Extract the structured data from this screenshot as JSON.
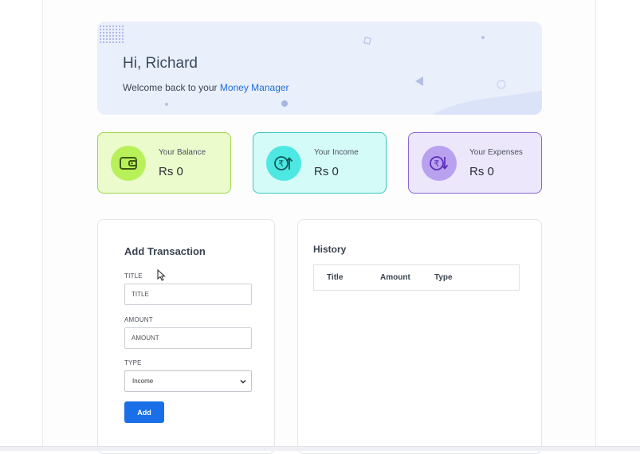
{
  "welcome": {
    "greeting": "Hi, Richard",
    "message_prefix": "Welcome back to your ",
    "app_name": "Money Manager"
  },
  "cards": {
    "balance": {
      "label": "Your Balance",
      "value": "Rs 0",
      "icon": "wallet-icon",
      "color": "#b8f05a"
    },
    "income": {
      "label": "Your Income",
      "value": "Rs 0",
      "icon": "rupee-up-icon",
      "color": "#4ee8e2"
    },
    "expenses": {
      "label": "Your Expenses",
      "value": "Rs 0",
      "icon": "rupee-down-icon",
      "color": "#b9a1f0"
    }
  },
  "add_transaction": {
    "heading": "Add Transaction",
    "title_label": "TITLE",
    "title_placeholder": "TITLE",
    "amount_label": "AMOUNT",
    "amount_placeholder": "AMOUNT",
    "type_label": "TYPE",
    "type_value": "Income",
    "add_button": "Add"
  },
  "history": {
    "heading": "History",
    "columns": [
      "Title",
      "Amount",
      "Type"
    ]
  },
  "colors": {
    "accent": "#1a6fe8",
    "brand_text": "#1f6fd6"
  }
}
